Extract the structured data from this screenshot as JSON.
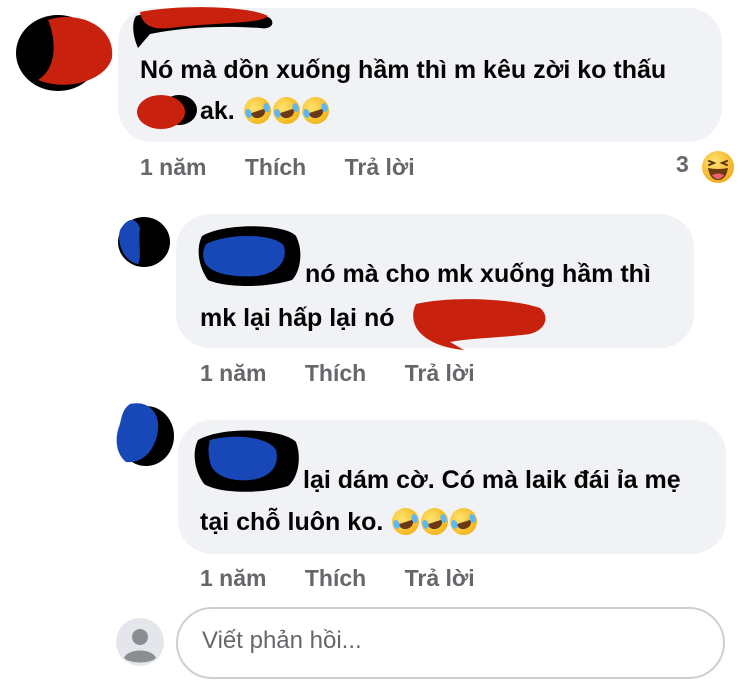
{
  "comments": [
    {
      "text_line1": "Nó mà dồn xuống hầm thì m kêu zời ko thấu",
      "text_line2": "ak.",
      "time": "1 năm",
      "like_label": "Thích",
      "reply_label": "Trả lời",
      "reaction_count": "3",
      "reaction_icon": "haha-reaction-icon"
    },
    {
      "text_line1": "nó mà cho mk xuống hầm thì",
      "text_line2": "mk lại hấp lại nó",
      "time": "1 năm",
      "like_label": "Thích",
      "reply_label": "Trả lời"
    },
    {
      "text_line1": "lại dám cờ. Có mà laik đái ỉa mẹ",
      "text_line2": "tại chỗ luôn ko.",
      "time": "1 năm",
      "like_label": "Thích",
      "reply_label": "Trả lời"
    }
  ],
  "reply_box": {
    "placeholder": "Viết phản hồi..."
  },
  "colors": {
    "bubble": "#f0f2f5",
    "meta_text": "#65676b",
    "redaction_red": "#c8220e",
    "redaction_blue": "#1848b8",
    "redaction_black": "#000000"
  }
}
